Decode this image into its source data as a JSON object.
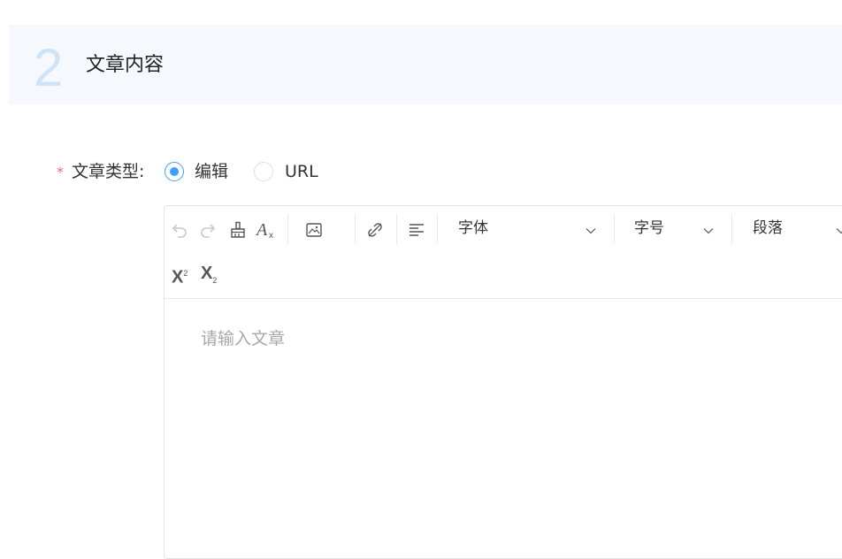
{
  "section": {
    "number": "2",
    "title": "文章内容"
  },
  "form": {
    "required_mark": "*",
    "label": "文章类型:",
    "options": [
      {
        "label": "编辑",
        "checked": true
      },
      {
        "label": "URL",
        "checked": false
      }
    ]
  },
  "toolbar": {
    "icons": [
      "undo-icon",
      "redo-icon",
      "format-painter-icon",
      "clear-format-icon",
      "image-icon",
      "unlink-icon",
      "align-icon"
    ],
    "font_select": "字体",
    "size_select": "字号",
    "paragraph_select": "段落",
    "superscript": "X",
    "superscript_mark": "2",
    "subscript": "X",
    "subscript_mark": "2"
  },
  "editor": {
    "placeholder": "请输入文章"
  },
  "colors": {
    "accent": "#409eff",
    "required": "#f56c6c",
    "header_bg": "#f5f9fe",
    "number": "#cfe3f7"
  }
}
